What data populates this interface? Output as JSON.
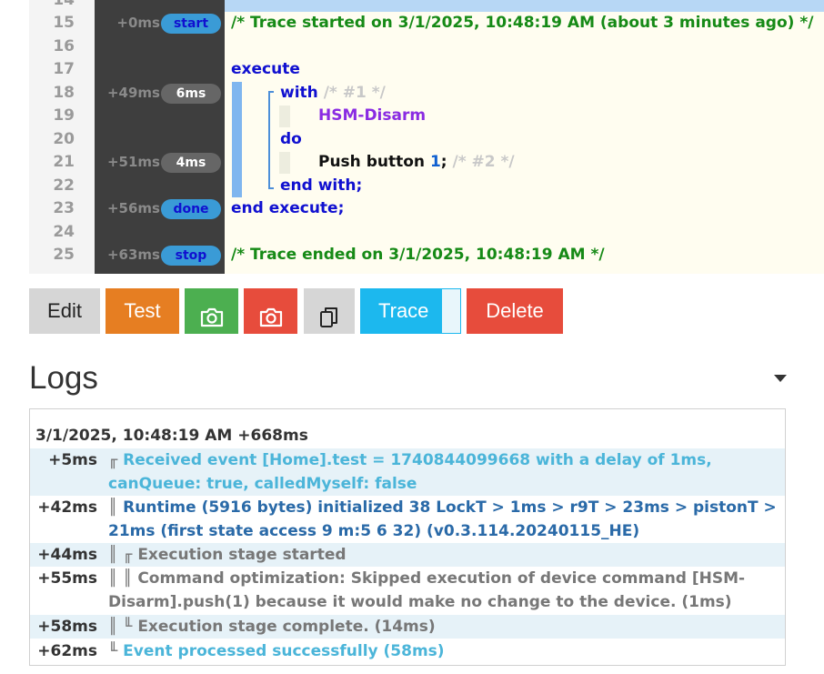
{
  "editor": {
    "line_numbers": [
      "14",
      "15",
      "16",
      "17",
      "18",
      "19",
      "20",
      "21",
      "22",
      "23",
      "24",
      "25"
    ],
    "trace": [
      {
        "line": "15",
        "time": "+0ms",
        "badge": "start",
        "color": "#3a9bd6"
      },
      {
        "line": "18",
        "time": "+49ms",
        "badge": "6ms",
        "color": "#666666"
      },
      {
        "line": "21",
        "time": "+51ms",
        "badge": "4ms",
        "color": "#666666"
      },
      {
        "line": "23",
        "time": "+56ms",
        "badge": "done",
        "color": "#3a9bd6"
      },
      {
        "line": "25",
        "time": "+63ms",
        "badge": "stop",
        "color": "#3a9bd6"
      }
    ],
    "code": {
      "trace_started": "/* Trace started on 3/1/2025, 10:48:19 AM (about 3 minutes ago) */",
      "execute": "execute",
      "with": "with",
      "with_comment": "/* #1 */",
      "device": "HSM-Disarm",
      "do": "do",
      "push": "Push button",
      "push_num": "1",
      "push_semicolon": ";",
      "push_comment": "/* #2 */",
      "end_with": "end with;",
      "end_execute": "end execute;",
      "trace_ended": "/* Trace ended on 3/1/2025, 10:48:19 AM */"
    }
  },
  "toolbar": {
    "edit_label": "Edit",
    "test_label": "Test",
    "snapshot_green_icon": "camera-icon",
    "snapshot_red_icon": "camera-icon",
    "copy_icon": "copy-icon",
    "trace_label": "Trace",
    "delete_label": "Delete"
  },
  "logs": {
    "title": "Logs",
    "header": "3/1/2025, 10:48:19 AM +668ms",
    "entries": [
      {
        "time": "+5ms",
        "prefix": "╓",
        "text": "Received event [Home].test = 1740844099668 with a delay of 1ms, canQueue: true, calledMyself: false",
        "color": "#4bb5d9"
      },
      {
        "time": "+42ms",
        "prefix": "║",
        "text": "Runtime (5916 bytes) initialized 38 LockT > 1ms > r9T > 23ms > pistonT > 21ms (first state access 9 m:5 6 32) (v0.3.114.20240115_HE)",
        "color": "#2a6aa8"
      },
      {
        "time": "+44ms",
        "prefix": "║ ╓",
        "text": "Execution stage started",
        "color": "#777777"
      },
      {
        "time": "+55ms",
        "prefix": "║ ║",
        "text": "Command optimization: Skipped execution of device command [HSM-Disarm].push(1) because it would make no change to the device. (1ms)",
        "color": "#777777"
      },
      {
        "time": "+58ms",
        "prefix": "║ ╙",
        "text": "Execution stage complete. (14ms)",
        "color": "#777777"
      },
      {
        "time": "+62ms",
        "prefix": "╙",
        "text": "Event processed successfully (58ms)",
        "color": "#4bb5d9"
      }
    ]
  }
}
